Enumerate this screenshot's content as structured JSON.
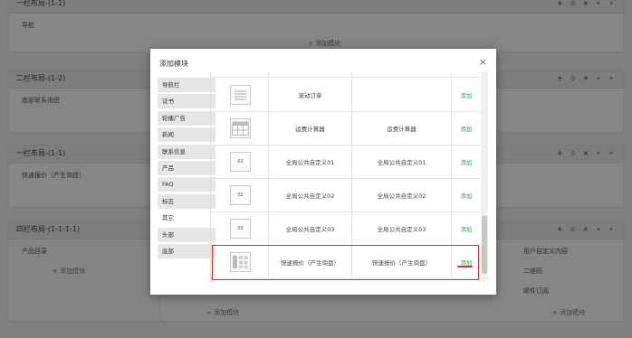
{
  "background": {
    "panel1": {
      "title": "一栏布局-(1-1)",
      "item": "导航",
      "add": "+ 添加模块"
    },
    "panel2": {
      "title": "二栏布局-(1-2)",
      "item": "底部联系询盘"
    },
    "panel3": {
      "title": "一栏布局-(1-1)",
      "item": "快速报价（产生询盘）"
    },
    "panel4": {
      "title": "四栏布局-(1-1-1-1)",
      "col1_item": "产品目录",
      "col1_add": "+ 添加模块",
      "col4_items": [
        "用户自定义内容",
        "二维码",
        "邮件订阅"
      ],
      "col4_add": "+ 添加模块",
      "bottom_add": "+ 添加模块"
    },
    "tools": "✚ ⚙ ✖ ✦ ✦"
  },
  "modal": {
    "title": "添加模块",
    "close": "×",
    "categories": [
      "导航栏",
      "证书",
      "轮播广告",
      "新闻",
      "联系信息",
      "产品",
      "FAQ",
      "标志",
      "其它",
      "头部",
      "底部"
    ],
    "active_category": "其它",
    "rows": [
      {
        "name": "",
        "desc": "",
        "action": "",
        "thumb": "",
        "icon": "partial-thumb-icon"
      },
      {
        "name": "滚动订单",
        "desc": "",
        "action": "添加",
        "thumb": "",
        "icon": "list-thumb-icon"
      },
      {
        "name": "运费计算器",
        "desc": "运费计算器",
        "action": "添加",
        "thumb": "",
        "icon": "table-thumb-icon"
      },
      {
        "name": "全局公共自定义01",
        "desc": "全局公共自定义01",
        "action": "添加",
        "thumb": "01",
        "icon": "custom-thumb-icon"
      },
      {
        "name": "全局公共自定义02",
        "desc": "全局公共自定义02",
        "action": "添加",
        "thumb": "02",
        "icon": "custom-thumb-icon"
      },
      {
        "name": "全局公共自定义03",
        "desc": "全局公共自定义03",
        "action": "添加",
        "thumb": "03",
        "icon": "custom-thumb-icon"
      },
      {
        "name": "快速报价（产生询盘）",
        "desc": "快速报价（产生询盘）",
        "action": "添加",
        "thumb": "",
        "icon": "quote-thumb-icon"
      }
    ],
    "highlight_color": "#d9302c",
    "action_color": "#2aa84a"
  }
}
